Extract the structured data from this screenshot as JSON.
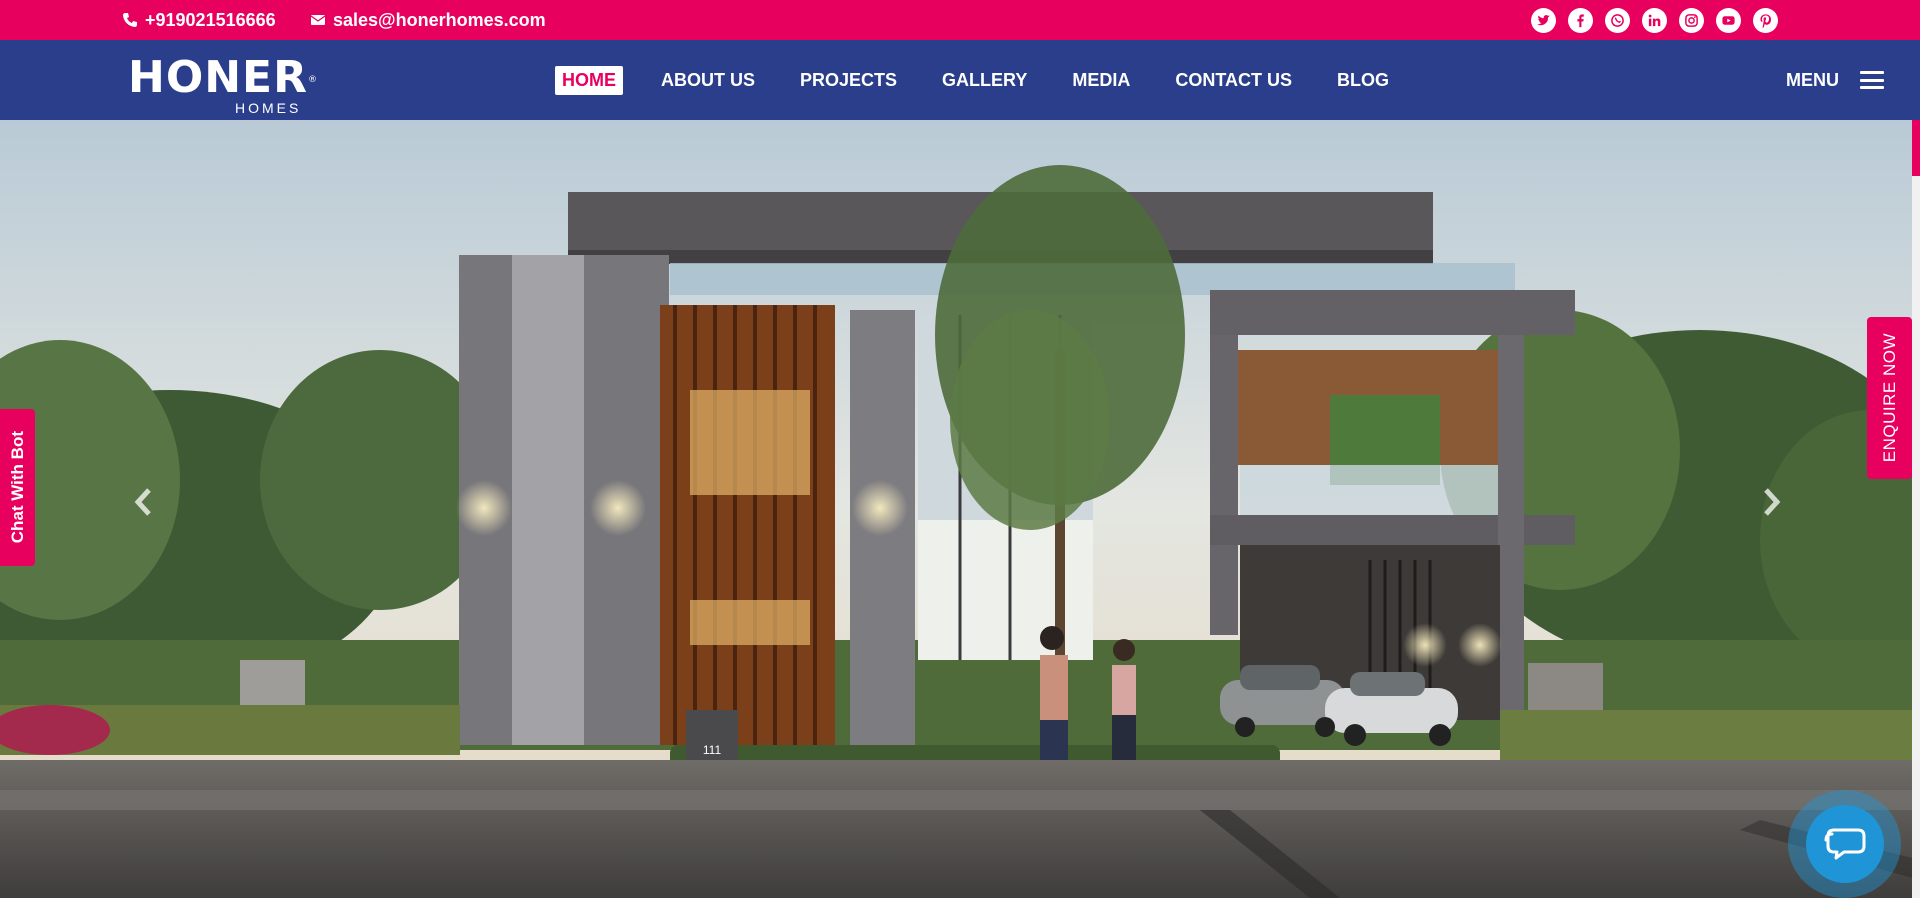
{
  "topbar": {
    "phone": "+919021516666",
    "email": "sales@honerhomes.com",
    "socials": [
      "twitter-icon",
      "facebook-icon",
      "whatsapp-icon",
      "linkedin-icon",
      "instagram-icon",
      "youtube-icon",
      "pinterest-icon"
    ]
  },
  "brand": {
    "name": "HONER",
    "tagline": "HOMES",
    "registered": "®"
  },
  "nav": {
    "items": [
      {
        "label": "HOME",
        "active": true
      },
      {
        "label": "ABOUT US"
      },
      {
        "label": "PROJECTS"
      },
      {
        "label": "GALLERY"
      },
      {
        "label": "MEDIA"
      },
      {
        "label": "CONTACT US"
      },
      {
        "label": "BLOG"
      }
    ],
    "menu_label": "MENU"
  },
  "hero": {
    "house_number": "111",
    "enquire_label": "ENQUIRE NOW",
    "chatbot_label": "Chat With Bot"
  },
  "colors": {
    "accent": "#e8005f",
    "nav_bg": "#2b3e8c",
    "chat": "#1f94d7"
  }
}
